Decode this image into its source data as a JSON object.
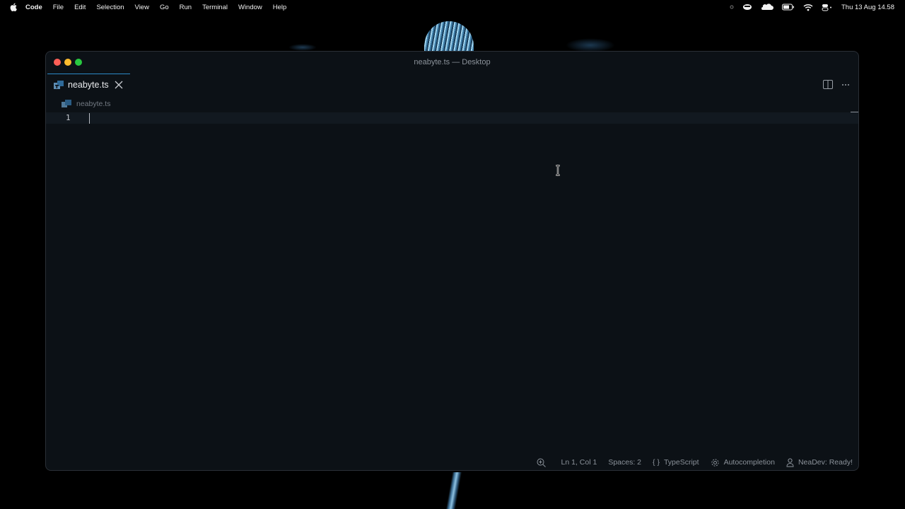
{
  "menubar": {
    "app_name": "Code",
    "items": [
      "File",
      "Edit",
      "Selection",
      "View",
      "Go",
      "Run",
      "Terminal",
      "Window",
      "Help"
    ],
    "clock": "Thu 13 Aug  14.58"
  },
  "window": {
    "title": "neabyte.ts — Desktop"
  },
  "tab": {
    "label": "neabyte.ts"
  },
  "breadcrumb": {
    "file": "neabyte.ts"
  },
  "editor": {
    "line_number": "1"
  },
  "statusbar": {
    "position": "Ln 1, Col 1",
    "spaces": "Spaces: 2",
    "language_braces": "{ }",
    "language": "TypeScript",
    "autocompletion": "Autocompletion",
    "neadev": "NeaDev: Ready!"
  }
}
